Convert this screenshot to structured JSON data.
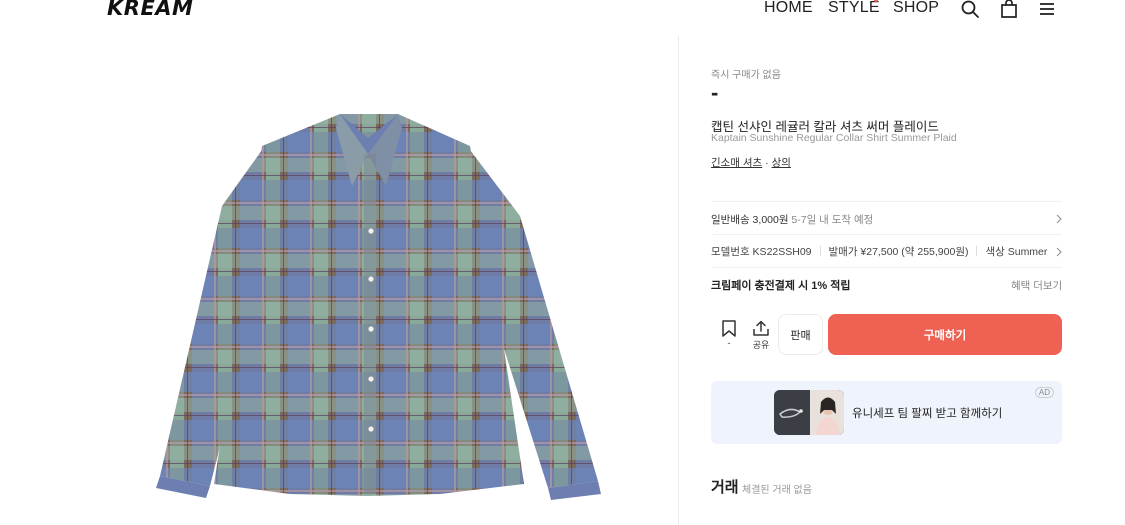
{
  "header": {
    "logo": "KREAM",
    "nav": [
      "HOME",
      "STYLE",
      "SHOP"
    ]
  },
  "product": {
    "status_label": "즉시 구매가 없음",
    "price": "-",
    "name_ko": "캡틴 선샤인 레귤러 칼라 셔츠 써머 플레이드",
    "name_en": "Kaptain Sunshine Regular Collar Shirt Summer Plaid",
    "category_1": "긴소매 셔츠",
    "category_sep": " · ",
    "category_2": "상의"
  },
  "shipping": {
    "label": "일반배송 3,000원",
    "eta": " 5-7일 내 도착 예정"
  },
  "info": {
    "model": "모델번호 KS22SSH09",
    "release": "발매가 ¥27,500 (약 255,900원)",
    "color": "색상 Summer Plaid"
  },
  "kream_pay": {
    "text": "크림페이 충전결제 시 1% 적립",
    "more": "혜택 더보기"
  },
  "actions": {
    "wish_count": "-",
    "share_label": "공유",
    "sell_label": "판매",
    "buy_label": "구매하기"
  },
  "banner": {
    "ad_label": "AD",
    "text": "유니세프 팀 팔찌 받고 함께하기"
  },
  "trade": {
    "title": "거래",
    "subtitle": "체결된 거래 없음"
  },
  "colors": {
    "accent": "#ef6253",
    "banner_bg": "#eff3fb"
  }
}
